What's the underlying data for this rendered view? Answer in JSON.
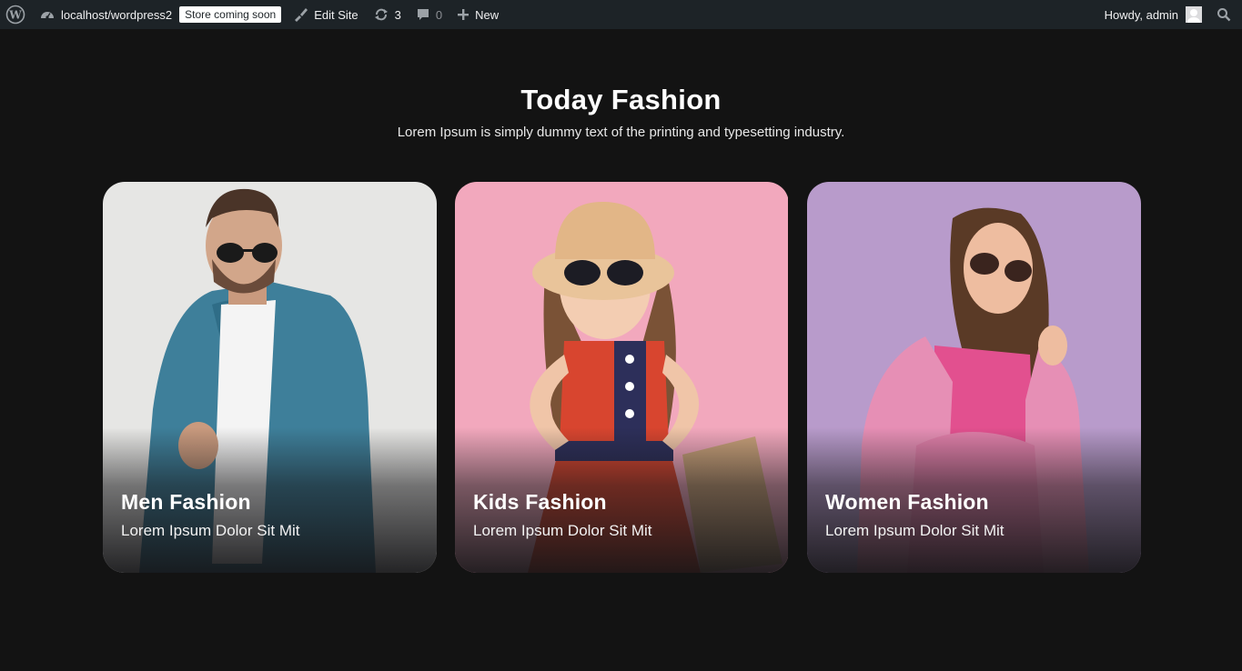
{
  "adminbar": {
    "site_url": "localhost/wordpress2",
    "store_badge": "Store coming soon",
    "edit_site": "Edit Site",
    "updates_count": "3",
    "comments_count": "0",
    "new_label": "New",
    "howdy": "Howdy, admin"
  },
  "section": {
    "title": "Today Fashion",
    "subtitle": "Lorem Ipsum is simply dummy text of the printing and typesetting industry."
  },
  "cards": [
    {
      "title": "Men Fashion",
      "subtitle": "Lorem Ipsum Dolor Sit Mit"
    },
    {
      "title": "Kids Fashion",
      "subtitle": "Lorem Ipsum Dolor Sit Mit"
    },
    {
      "title": "Women Fashion",
      "subtitle": "Lorem Ipsum Dolor Sit Mit"
    }
  ],
  "colors": {
    "adminbar_bg": "#1d2327",
    "page_bg": "#131313",
    "card_men_bg": "#e6e6e4",
    "card_kids_bg": "#f2a8bd",
    "card_women_bg": "#b89bcb"
  }
}
